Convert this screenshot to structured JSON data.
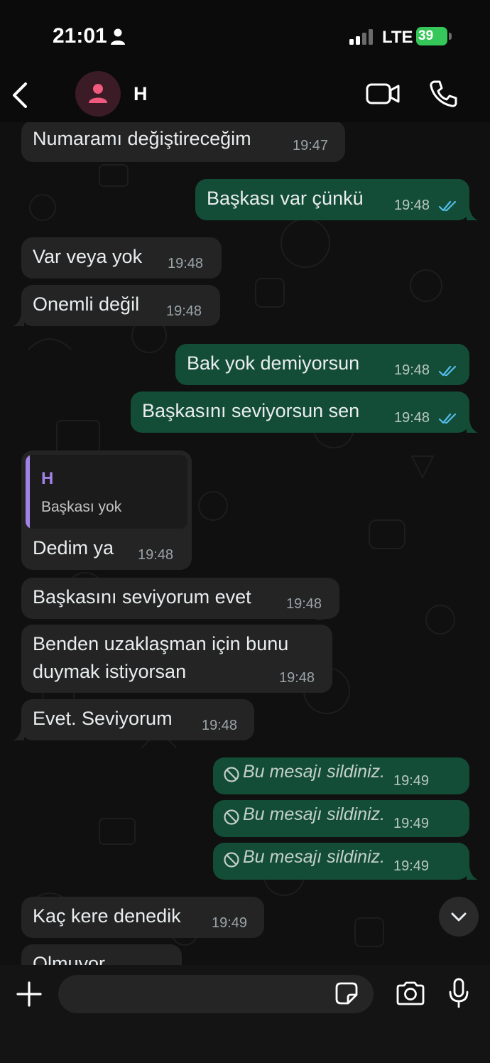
{
  "status_bar": {
    "time": "21:01",
    "network": "LTE",
    "battery": "39",
    "battery_color": "#35c759",
    "icons": [
      "person-icon",
      "signal-bars-icon",
      "battery-charging-icon"
    ]
  },
  "header": {
    "contact_name": "H",
    "avatar_color": "#3a1b26",
    "icons": [
      "back-chevron-icon",
      "avatar-person-icon",
      "video-camera-icon",
      "phone-icon"
    ]
  },
  "messages": [
    {
      "direction": "in",
      "text": "Numaramı değiştireceğim",
      "time": "19:47"
    },
    {
      "direction": "out",
      "text": "Başkası var çünkü",
      "time": "19:48",
      "read": true
    },
    {
      "direction": "in",
      "text": "Var veya yok",
      "time": "19:48"
    },
    {
      "direction": "in",
      "text": "Onemli değil",
      "time": "19:48"
    },
    {
      "direction": "out",
      "text": "Bak yok demiyorsun",
      "time": "19:48",
      "read": true
    },
    {
      "direction": "out",
      "text": "Başkasını seviyorsun sen",
      "time": "19:48",
      "read": true
    },
    {
      "direction": "in",
      "text": "Dedim ya",
      "time": "19:48",
      "reply_to": {
        "name": "H",
        "text": "Başkası yok"
      }
    },
    {
      "direction": "in",
      "text": "Başkasını seviyorum evet",
      "time": "19:48"
    },
    {
      "direction": "in",
      "text_line1": "Benden uzaklaşman için bunu",
      "text_line2": "duymak istiyorsan",
      "time": "19:48"
    },
    {
      "direction": "in",
      "text": "Evet. Seviyorum",
      "time": "19:48"
    },
    {
      "direction": "out",
      "deleted": true,
      "text": "Bu mesajı sildiniz.",
      "time": "19:49"
    },
    {
      "direction": "out",
      "deleted": true,
      "text": "Bu mesajı sildiniz.",
      "time": "19:49"
    },
    {
      "direction": "out",
      "deleted": true,
      "text": "Bu mesajı sildiniz.",
      "time": "19:49"
    },
    {
      "direction": "in",
      "text": "Kaç kere denedik",
      "time": "19:49"
    },
    {
      "direction": "in",
      "text": "Olmuyor",
      "time": ""
    }
  ],
  "colors": {
    "incoming_bubble": "#242424",
    "outgoing_bubble": "#144d37",
    "read_ticks": "#53bdeb",
    "quote_accent": "#a183e8"
  },
  "composer": {
    "placeholder": "",
    "icons": [
      "plus-icon",
      "sticker-icon",
      "camera-icon",
      "microphone-icon"
    ]
  }
}
